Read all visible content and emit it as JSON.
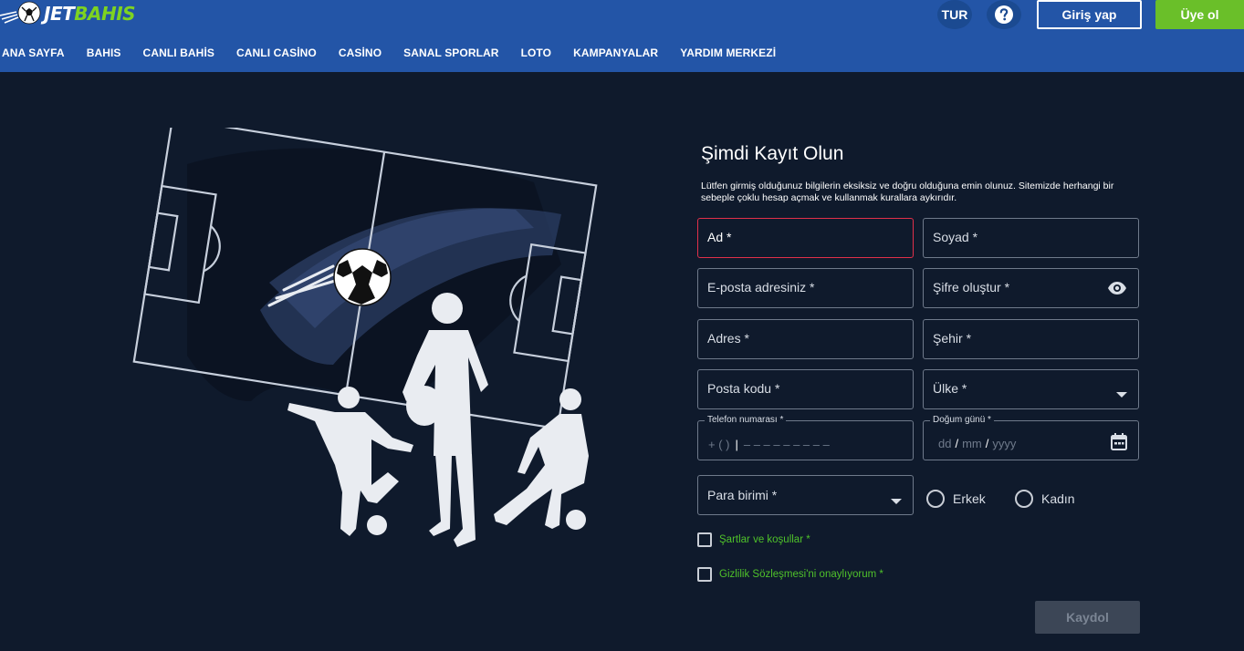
{
  "header": {
    "logo_jet": "JET",
    "logo_bahis": "BAHIS",
    "lang": "TUR",
    "login": "Giriş yap",
    "signup": "Üye ol"
  },
  "nav": [
    "ANA SAYFA",
    "BAHIS",
    "CANLI BAHİS",
    "CANLI CASİNO",
    "CASİNO",
    "SANAL SPORLAR",
    "LOTO",
    "KAMPANYALAR",
    "YARDIM MERKEZİ"
  ],
  "form": {
    "title": "Şimdi Kayıt Olun",
    "description": "Lütfen girmiş olduğunuz bilgilerin eksiksiz ve doğru olduğuna emin olunuz. Sitemizde herhangi bir sebeple çoklu hesap açmak ve kullanmak kurallara aykırıdır.",
    "first_name": "Ad *",
    "last_name": "Soyad *",
    "email": "E-posta adresiniz *",
    "password": "Şifre oluştur *",
    "address": "Adres *",
    "city": "Şehir *",
    "postcode": "Posta kodu *",
    "country": "Ülke *",
    "phone_label": "Telefon numarası *",
    "phone_prefix": "+ (     )",
    "phone_caret": "|",
    "phone_mask": "– – – – – – – – –",
    "dob_label": "Doğum günü *",
    "dob_dd": "dd",
    "dob_mm": "mm",
    "dob_yyyy": "yyyy",
    "dob_sep": "/",
    "currency": "Para birimi *",
    "gender_male": "Erkek",
    "gender_female": "Kadın",
    "terms": "Şartlar ve koşullar *",
    "privacy": "Gizlilik Sözleşmesi'ni onaylıyorum *",
    "submit": "Kaydol"
  },
  "colors": {
    "header_bg": "#2355a7",
    "page_bg": "#0f1a2c",
    "accent_green": "#6abf29",
    "error_red": "#e0304a"
  }
}
